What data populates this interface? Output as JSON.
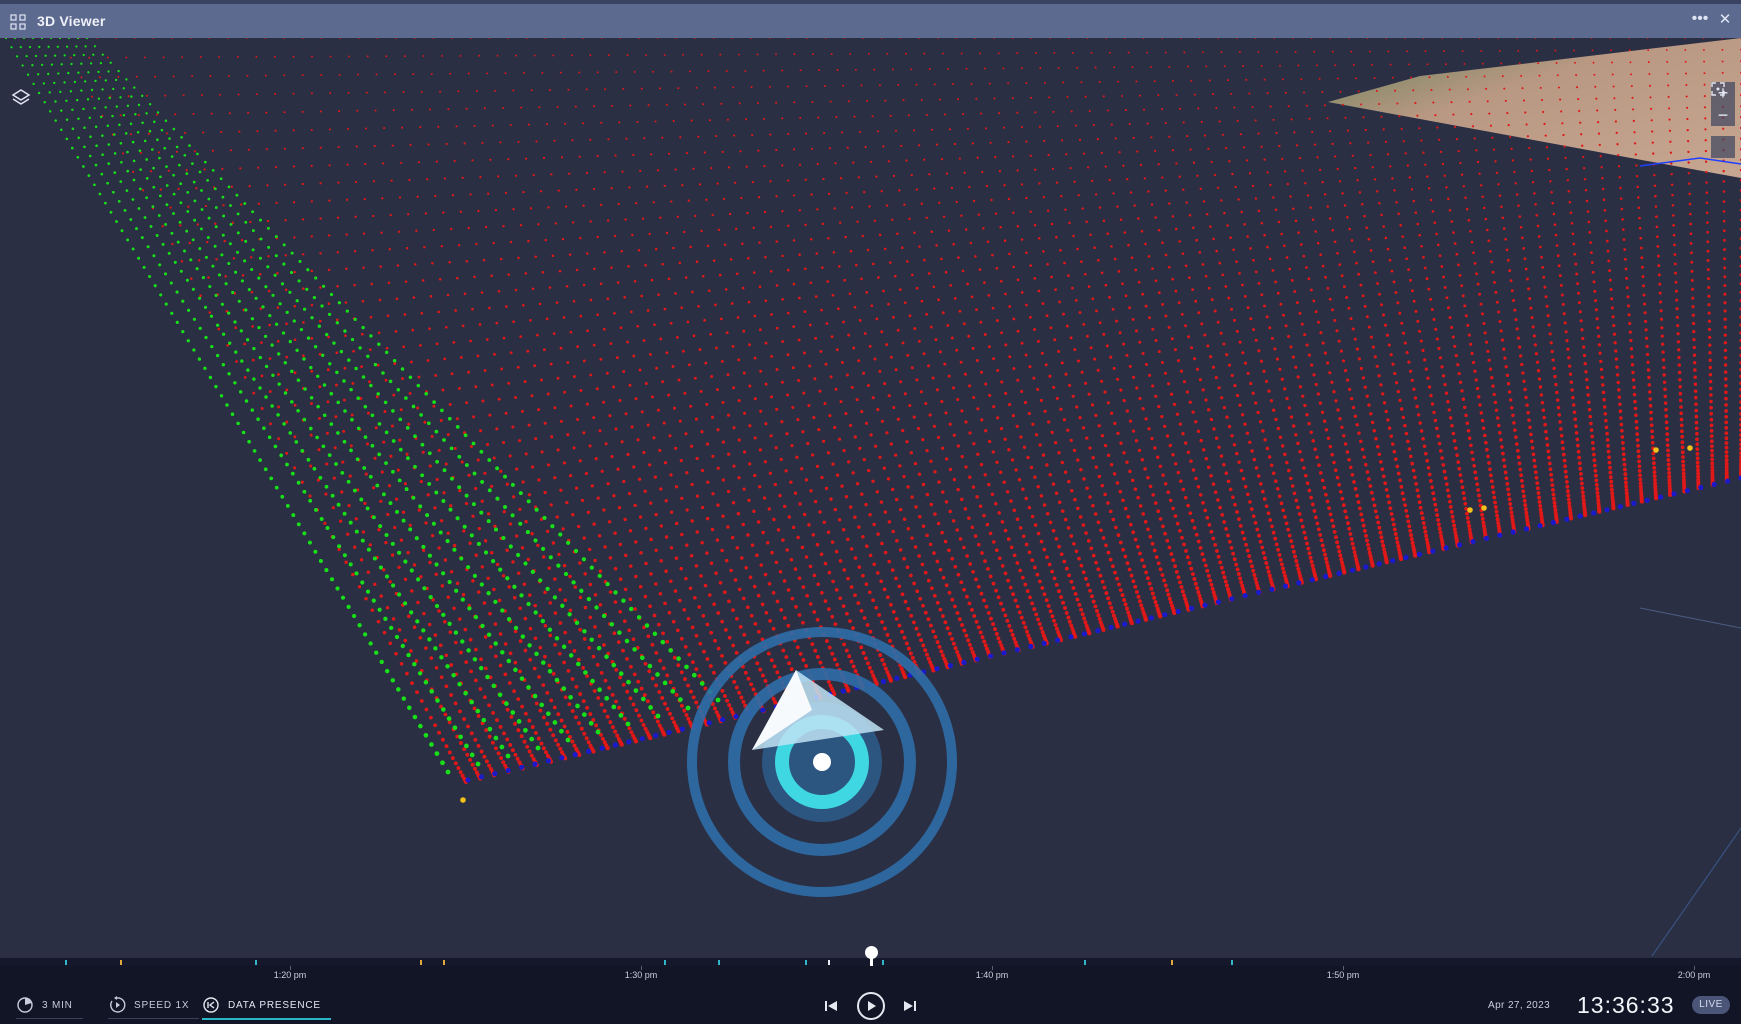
{
  "window": {
    "title": "3D Viewer",
    "more_label": "•••",
    "close_label": "✕"
  },
  "map_controls": {
    "zoom_in": "+",
    "zoom_out": "−"
  },
  "timeline": {
    "axis_labels": [
      "1:20 pm",
      "1:30 pm",
      "1:40 pm",
      "1:50 pm",
      "2:00 pm"
    ]
  },
  "controls": {
    "window_label": "3 MIN",
    "speed_label": "SPEED 1X",
    "data_presence_label": "DATA PRESENCE"
  },
  "status": {
    "date": "Apr 27, 2023",
    "time": "13:36:33",
    "live_label": "LIVE"
  },
  "colors": {
    "pointcloud": "#e01818",
    "track_lines": "#18e018",
    "path": "#1a1acc",
    "marker_ring": "#2f6ea8",
    "marker_core": "#3fd7e2",
    "accent": "#28b7c9"
  }
}
